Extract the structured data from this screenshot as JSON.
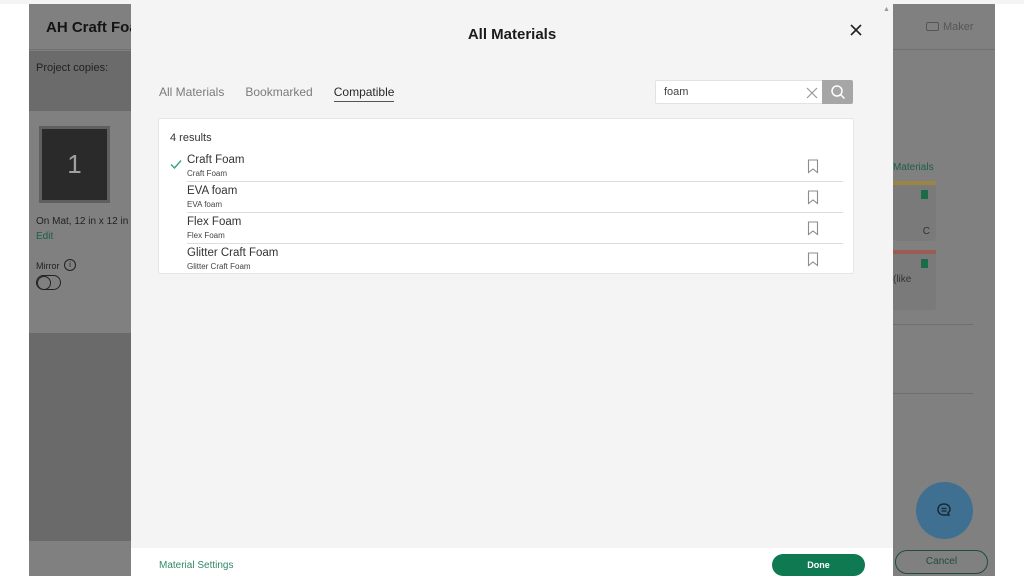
{
  "background_app": {
    "project_title": "AH Craft Foam",
    "project_copies_label": "Project copies:",
    "mat_number": "1",
    "mat_info": "On Mat, 12 in x 12 in",
    "edit_link": "Edit",
    "mirror_label": "Mirror",
    "machine_label": "Maker",
    "materials_link": "Materials",
    "card_text_1": "C",
    "card_text_2": "(like",
    "cancel_label": "Cancel",
    "colors": {
      "card_bar_1": "#b59a4a",
      "card_bar_2": "#b46a5e",
      "accent": "#1c5d45"
    }
  },
  "modal": {
    "title": "All Materials",
    "tabs": [
      {
        "label": "All Materials",
        "active": false
      },
      {
        "label": "Bookmarked",
        "active": false
      },
      {
        "label": "Compatible",
        "active": true
      }
    ],
    "search": {
      "value": "foam",
      "placeholder": ""
    },
    "results_count": "4 results",
    "results": [
      {
        "name": "Craft Foam",
        "subtitle": "Craft Foam",
        "selected": true,
        "bookmarked": false
      },
      {
        "name": "EVA foam",
        "subtitle": "EVA foam",
        "selected": false,
        "bookmarked": false
      },
      {
        "name": "Flex Foam",
        "subtitle": "Flex Foam",
        "selected": false,
        "bookmarked": false
      },
      {
        "name": "Glitter Craft Foam",
        "subtitle": "Glitter Craft Foam",
        "selected": false,
        "bookmarked": false
      }
    ],
    "footer": {
      "material_settings_label": "Material Settings",
      "done_label": "Done"
    },
    "colors": {
      "primary": "#0f7a52",
      "link": "#2f8a66"
    }
  }
}
